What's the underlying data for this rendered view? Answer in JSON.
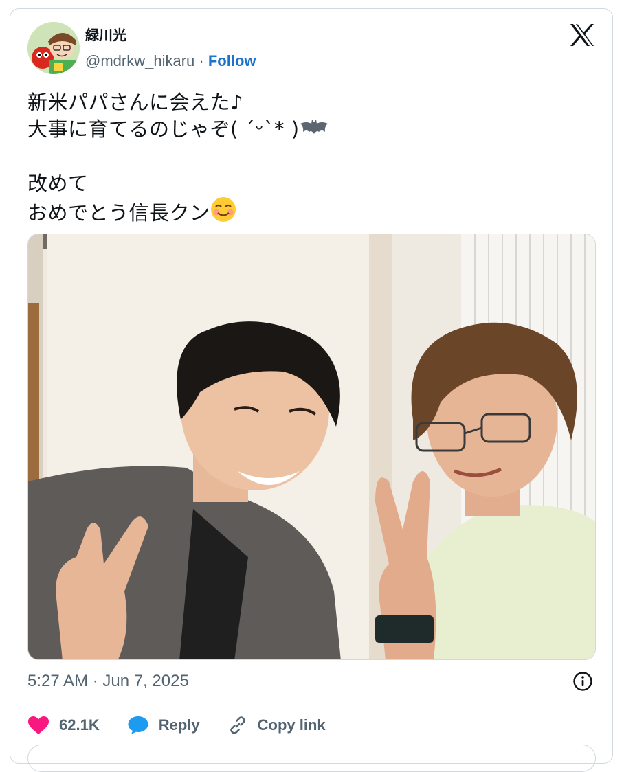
{
  "author": {
    "display_name": "緑川光",
    "handle": "@mdrkw_hikaru",
    "separator": "·",
    "follow_label": "Follow"
  },
  "tweet": {
    "text_line1": "新米パパさんに会えた♪",
    "text_line2": "大事に育てるのじゃぞ( ˊᵕˋ* )",
    "text_line3": "改めて",
    "text_line4": "おめでとう信長クン",
    "timestamp": "5:27 AM · Jun 7, 2025"
  },
  "actions": {
    "like_count": "62.1K",
    "reply_label": "Reply",
    "copy_link_label": "Copy link"
  },
  "icons": {
    "brand": "x-logo-icon",
    "bat": "bat-emoji-icon",
    "smile": "smiling-face-emoji-icon",
    "info": "info-icon",
    "like": "heart-icon",
    "reply": "speech-bubble-icon",
    "link": "link-icon"
  },
  "colors": {
    "accent": "#1d73c9",
    "heart": "#f91880",
    "muted": "#536471",
    "border": "#cfd9de",
    "reply_bubble": "#1d9bf0"
  }
}
